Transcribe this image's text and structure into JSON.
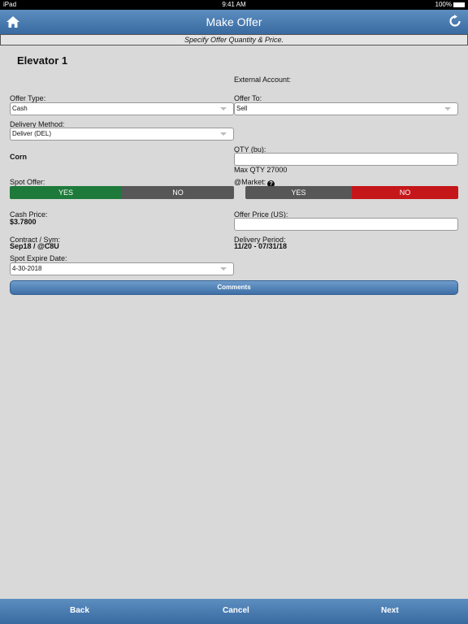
{
  "status_bar": {
    "device": "iPad",
    "time": "9:41 AM",
    "battery": "100%"
  },
  "nav": {
    "title": "Make Offer"
  },
  "subheader": "Specify Offer Quantity & Price.",
  "location": "Elevator 1",
  "form": {
    "external_account_label": "External Account:",
    "offer_type_label": "Offer Type:",
    "offer_type_value": "Cash",
    "offer_to_label": "Offer To:",
    "offer_to_value": "Sell",
    "delivery_method_label": "Delivery Method:",
    "delivery_method_value": "Deliver (DEL)",
    "commodity": "Corn",
    "qty_label": "QTY (bu):",
    "max_qty": "Max QTY 27000",
    "spot_offer_label": "Spot Offer:",
    "spot_yes": "YES",
    "spot_no": "NO",
    "market_label": "@Market:",
    "market_yes": "YES",
    "market_no": "NO",
    "cash_price_label": "Cash Price:",
    "cash_price_value": "$3.7800",
    "offer_price_label": "Offer Price (US):",
    "contract_label": "Contract / Sym:",
    "contract_value": "Sep18 / @C8U",
    "delivery_period_label": "Delivery Period:",
    "delivery_period_value": "11/20 - 07/31/18",
    "spot_expire_label": "Spot Expire Date:",
    "spot_expire_value": "4-30-2018",
    "comments_label": "Comments"
  },
  "bottom": {
    "back": "Back",
    "cancel": "Cancel",
    "next": "Next"
  },
  "colors": {
    "nav": "#4a7db3",
    "yes_active": "#1d7a3a",
    "no_active": "#c5161a",
    "inactive": "#575757",
    "background": "#d9d9d9"
  }
}
